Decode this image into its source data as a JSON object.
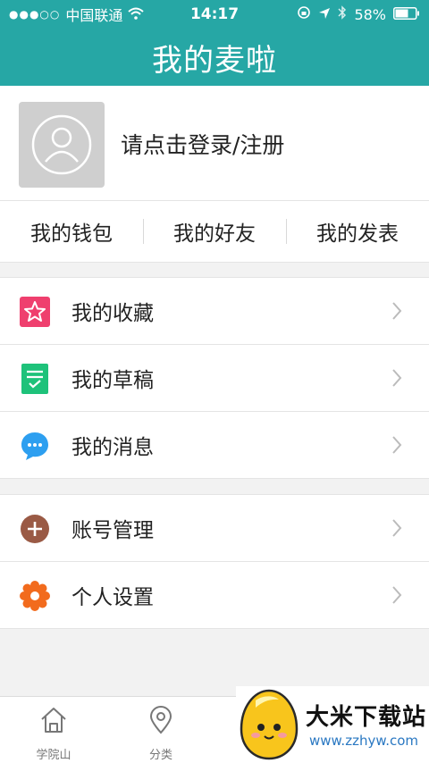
{
  "status_bar": {
    "carrier": "中国联通",
    "time": "14:17",
    "battery": "58%"
  },
  "header": {
    "title": "我的麦啦"
  },
  "profile": {
    "login_prompt": "请点击登录/注册"
  },
  "quick_tabs": [
    "我的钱包",
    "我的好友",
    "我的发表"
  ],
  "menu_group1": [
    {
      "label": "我的收藏",
      "icon": "star-icon",
      "color": "#ef3f6e"
    },
    {
      "label": "我的草稿",
      "icon": "draft-icon",
      "color": "#1ec27a"
    },
    {
      "label": "我的消息",
      "icon": "message-icon",
      "color": "#2d9ff0"
    }
  ],
  "menu_group2": [
    {
      "label": "账号管理",
      "icon": "plus-circle-icon",
      "color": "#9a5a45"
    },
    {
      "label": "个人设置",
      "icon": "gear-icon",
      "color": "#f26b1d"
    }
  ],
  "bottom_nav": [
    {
      "label": "学院山",
      "icon": "home-icon"
    },
    {
      "label": "分类",
      "icon": "location-icon"
    }
  ],
  "watermark": {
    "title": "大米下载站",
    "url": "www.zzhyw.com"
  },
  "colors": {
    "accent": "#26a7a5",
    "background": "#f2f2f2"
  }
}
